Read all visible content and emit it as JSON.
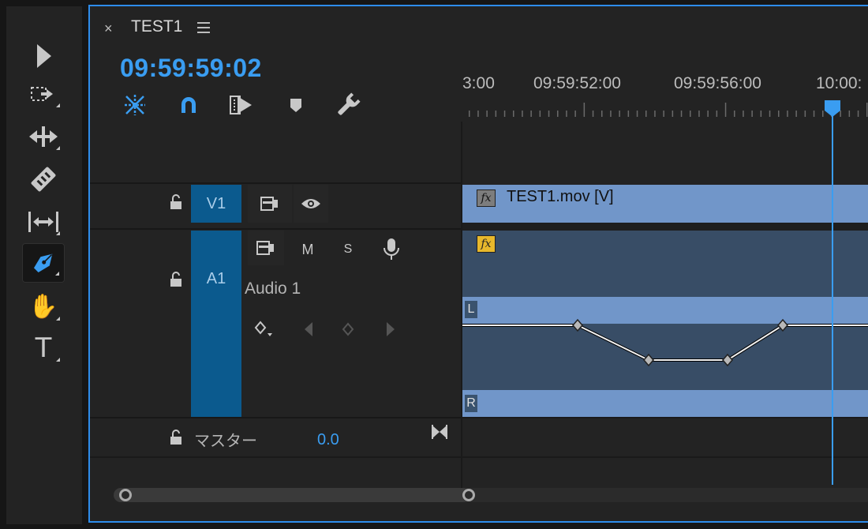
{
  "tools": [
    {
      "name": "selection-tool",
      "icon": "arrow-icon",
      "glyph": ""
    },
    {
      "name": "track-select-tool",
      "icon": "track-select-icon",
      "glyph": ""
    },
    {
      "name": "ripple-edit-tool",
      "icon": "ripple-edit-icon",
      "glyph": ""
    },
    {
      "name": "razor-tool",
      "icon": "razor-icon",
      "glyph": ""
    },
    {
      "name": "slip-tool",
      "icon": "slip-icon",
      "glyph": ""
    },
    {
      "name": "pen-tool",
      "icon": "pen-icon",
      "glyph": "",
      "active": true
    },
    {
      "name": "hand-tool",
      "icon": "hand-icon",
      "glyph": "✋"
    },
    {
      "name": "type-tool",
      "icon": "type-icon",
      "glyph": "T"
    }
  ],
  "sequence": {
    "tab_close": "×",
    "title": "TEST1",
    "timecode": "09:59:59:02"
  },
  "timeline_tools": [
    "snap-icon",
    "linked-selection-icon",
    "add-edit-icon",
    "marker-icon",
    "wrench-icon"
  ],
  "ruler": {
    "labels": [
      "3:00",
      "09:59:52:00",
      "09:59:56:00",
      "10:00:"
    ]
  },
  "tracks": {
    "video": {
      "label": "V1",
      "clip_name": "TEST1.mov [V]",
      "fx": "fx"
    },
    "audio": {
      "label": "A1",
      "mute": "M",
      "solo": "S",
      "name": "Audio 1",
      "fx": "fx",
      "left_channel": "L",
      "right_channel": "R",
      "keyframe_levels": [
        0,
        -1,
        -1,
        0
      ]
    },
    "master": {
      "label": "マスター",
      "value": "0.0"
    }
  },
  "colors": {
    "accent": "#3a9df1",
    "track_label_bg": "#0b5a8e",
    "clip_blue": "#7196c9",
    "audio_clip_bg": "#384d66",
    "fx_video": "#7d7d7d",
    "fx_audio": "#e8b82c"
  }
}
